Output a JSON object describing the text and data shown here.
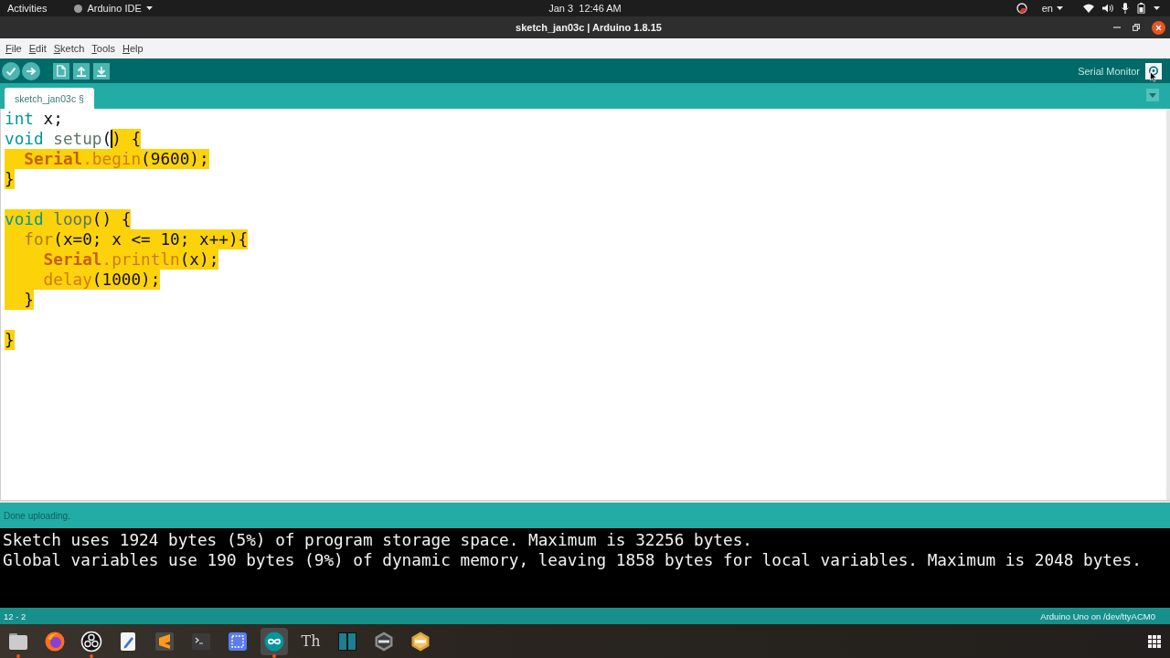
{
  "top_bar": {
    "activities": "Activities",
    "app_menu": "Arduino IDE",
    "clock": "Jan 3  12:46 AM",
    "language": "en"
  },
  "window": {
    "title": "sketch_jan03c | Arduino 1.8.15"
  },
  "menu": [
    "File",
    "Edit",
    "Sketch",
    "Tools",
    "Help"
  ],
  "toolbar": {
    "buttons": [
      {
        "kind": "verify"
      },
      {
        "kind": "upload"
      },
      {
        "kind": "new"
      },
      {
        "kind": "open"
      },
      {
        "kind": "save"
      }
    ],
    "serial_monitor": "Serial Monitor"
  },
  "tabs": [
    {
      "label": "sketch_jan03c §",
      "selected": true
    }
  ],
  "editor": {
    "lines": [
      {
        "kind": "code",
        "segments": [
          {
            "text": "int",
            "kind": "keyword",
            "selected": false
          },
          {
            "text": " x;",
            "kind": "plain",
            "selected": false
          }
        ]
      },
      {
        "kind": "code",
        "segments": [
          {
            "text": "void",
            "kind": "keyword",
            "selected": false
          },
          {
            "text": " setup",
            "kind": "function",
            "selected": false
          },
          {
            "text": "(",
            "kind": "plain",
            "selected": false
          },
          {
            "kind": "caret",
            "selected": false
          },
          {
            "text": ") {",
            "kind": "plain",
            "selected": true
          }
        ]
      },
      {
        "kind": "code",
        "segments": [
          {
            "text": "  Serial",
            "kind": "class",
            "selected": true
          },
          {
            "text": ".begin",
            "kind": "method",
            "selected": true
          },
          {
            "text": "(9600);",
            "kind": "plain",
            "selected": true
          }
        ]
      },
      {
        "kind": "code",
        "segments": [
          {
            "text": "}",
            "kind": "plain",
            "selected": true
          }
        ]
      },
      {
        "kind": "blank"
      },
      {
        "kind": "code",
        "segments": [
          {
            "text": "void",
            "kind": "keyword",
            "selected": true
          },
          {
            "text": " loop",
            "kind": "function",
            "selected": true
          },
          {
            "text": "() {",
            "kind": "plain",
            "selected": true
          }
        ]
      },
      {
        "kind": "code",
        "segments": [
          {
            "text": "  for",
            "kind": "control",
            "selected": true
          },
          {
            "text": "(x=0; x <= 10; x++){",
            "kind": "plain",
            "selected": true
          }
        ]
      },
      {
        "kind": "code",
        "segments": [
          {
            "text": "    Serial",
            "kind": "class",
            "selected": true
          },
          {
            "text": ".println",
            "kind": "method",
            "selected": true
          },
          {
            "text": "(x);",
            "kind": "plain",
            "selected": true
          }
        ]
      },
      {
        "kind": "code",
        "segments": [
          {
            "text": "    delay",
            "kind": "method",
            "selected": true
          },
          {
            "text": "(1000);",
            "kind": "plain",
            "selected": true
          }
        ]
      },
      {
        "kind": "code",
        "segments": [
          {
            "text": "  }",
            "kind": "plain",
            "selected": true
          }
        ]
      },
      {
        "kind": "blank"
      },
      {
        "kind": "code",
        "segments": [
          {
            "text": "}",
            "kind": "plain",
            "selected": true
          }
        ]
      }
    ]
  },
  "status_message": "Done uploading.",
  "console": [
    "Sketch uses 1924 bytes (5%) of program storage space. Maximum is 32256 bytes.",
    "Global variables use 190 bytes (9%) of dynamic memory, leaving 1858 bytes for local variables. Maximum is 2048 bytes."
  ],
  "status_bar": {
    "position": "12 - 2",
    "board": "Arduino Uno on /dev/ttyACM0"
  },
  "dock": {
    "apps": [
      {
        "kind": "files",
        "running": true,
        "selected": false
      },
      {
        "kind": "browser",
        "running": false,
        "selected": false
      },
      {
        "kind": "recorder",
        "running": true,
        "selected": false
      },
      {
        "kind": "notes",
        "running": false,
        "selected": false
      },
      {
        "kind": "sublime",
        "running": false,
        "selected": false
      },
      {
        "kind": "terminal",
        "running": false,
        "selected": false
      },
      {
        "kind": "screenshot",
        "running": false,
        "selected": false
      },
      {
        "kind": "arduino",
        "running": true,
        "selected": true
      },
      {
        "kind": "glyph",
        "glyph": "Th",
        "running": false,
        "selected": false
      },
      {
        "kind": "panels",
        "running": false,
        "selected": false
      },
      {
        "kind": "hex-gray",
        "running": false,
        "selected": false
      },
      {
        "kind": "hex-gold",
        "running": false,
        "selected": false
      }
    ]
  }
}
